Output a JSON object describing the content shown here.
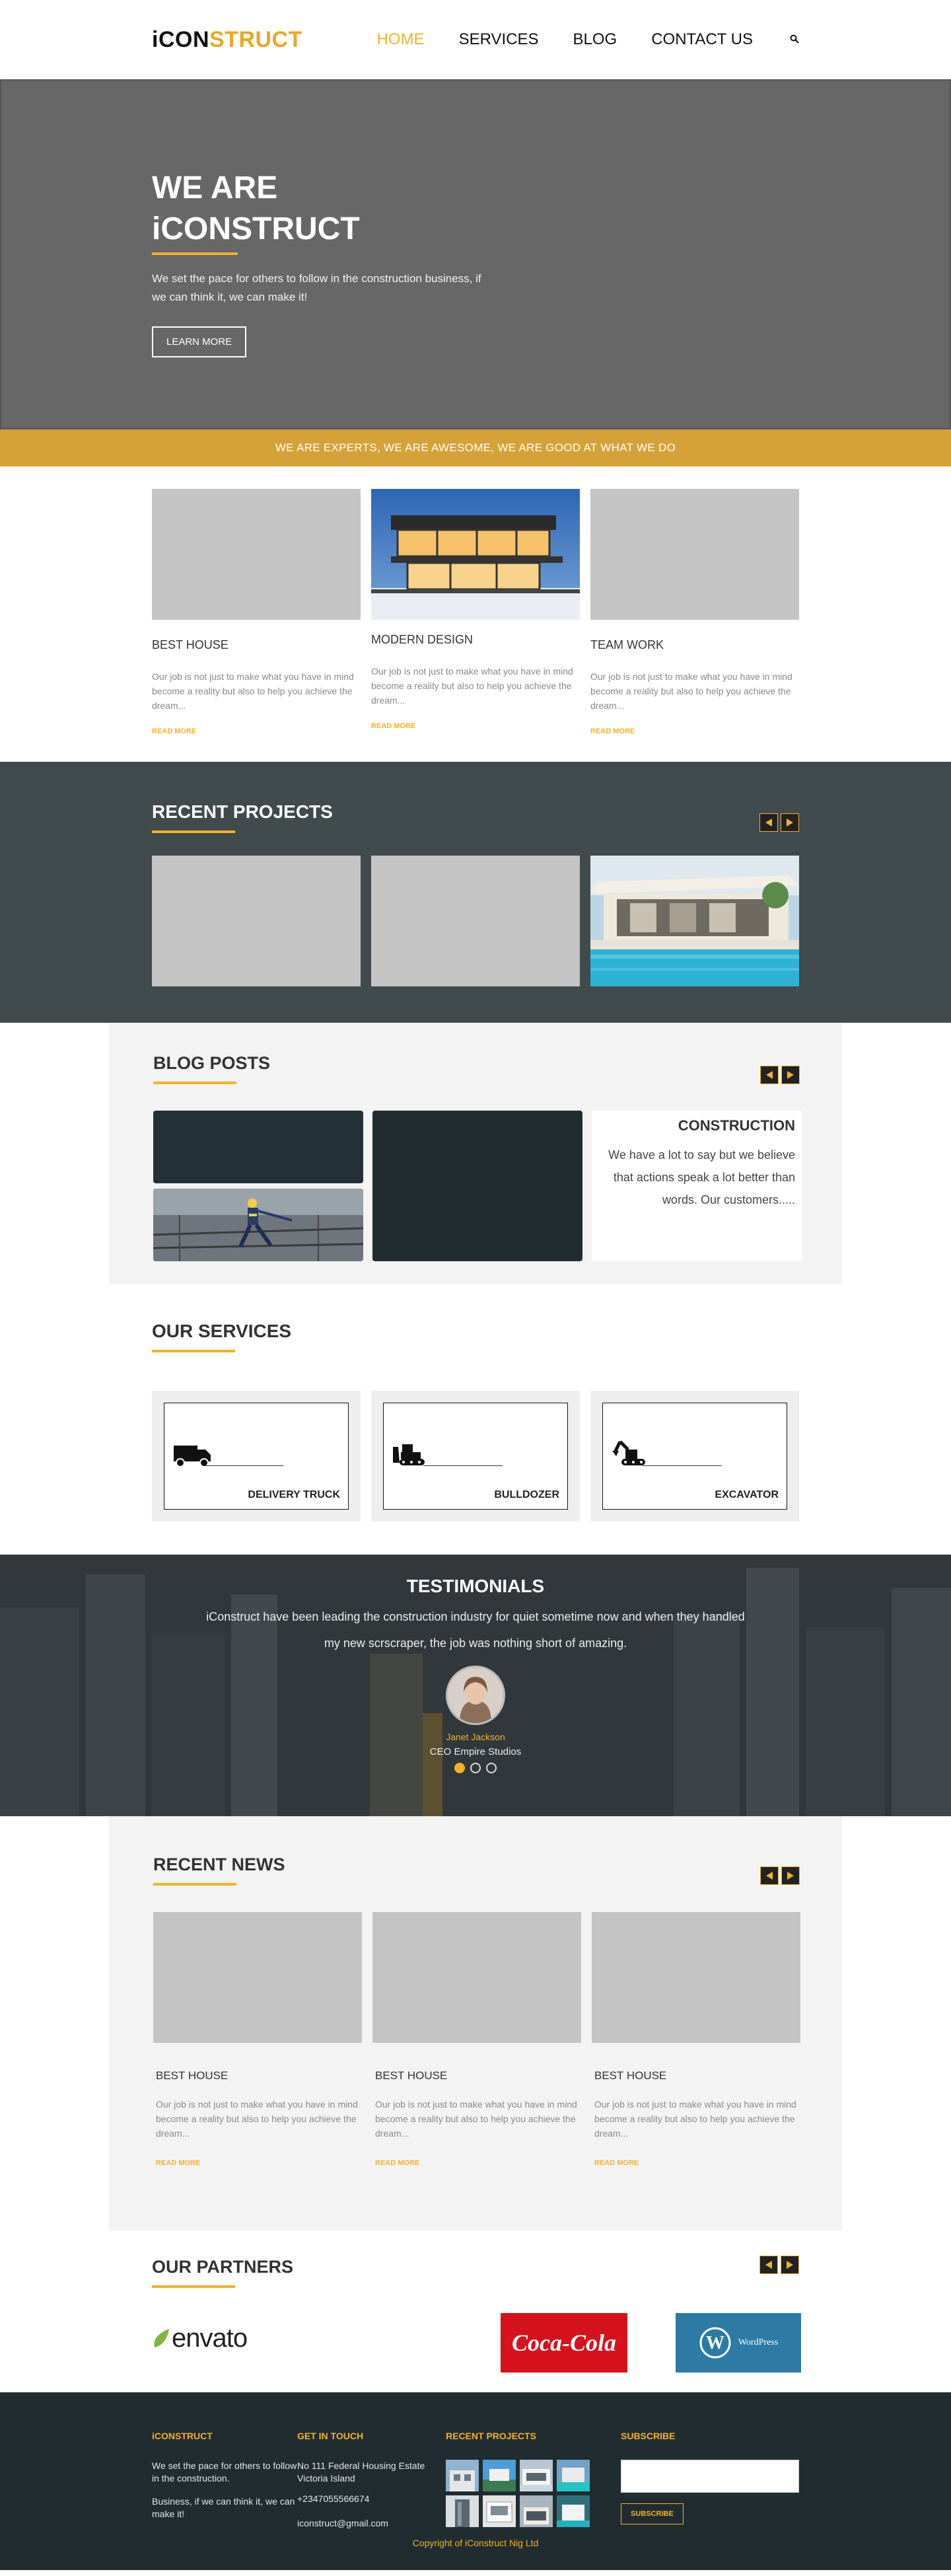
{
  "nav": {
    "logo_prefix": "iCON",
    "logo_suffix": "STRUCT",
    "items": [
      {
        "label": "HOME",
        "active": true
      },
      {
        "label": "SERVICES"
      },
      {
        "label": "BLOG"
      },
      {
        "label": "CONTACT US"
      }
    ],
    "search_icon": "magnifier"
  },
  "hero": {
    "line1": "WE ARE",
    "line2": "iCONSTRUCT",
    "text": "We set the pace for others to follow in the construction business, if we can think it, we can make it!",
    "button": "LEARN MORE"
  },
  "banner": "WE ARE EXPERTS, WE ARE AWESOME, WE ARE GOOD AT WHAT WE DO",
  "features": [
    {
      "title": "BEST HOUSE",
      "text": "Our job is not just to make what you have in mind become a reality but also to help you achieve the dream...",
      "more": "READ MORE"
    },
    {
      "title": "MODERN DESIGN",
      "text": "Our job is not just to make what you have in mind become a reality but also to help you achieve the dream...",
      "more": "READ MORE"
    },
    {
      "title": "TEAM WORK",
      "text": "Our job is not just to make what you have in mind become a reality but also to help you achieve the dream...",
      "more": "READ MORE"
    }
  ],
  "projects": {
    "title": "RECENT PROJECTS"
  },
  "blog": {
    "title": "BLOG POSTS",
    "post_title": "CONSTRUCTION",
    "post_text": "We have a lot to say but we believe that actions speak a lot better than words. Our customers....."
  },
  "services": {
    "title": "OUR SERVICES",
    "items": [
      {
        "label": "DELIVERY TRUCK",
        "icon": "truck-icon"
      },
      {
        "label": "BULLDOZER",
        "icon": "bulldozer-icon"
      },
      {
        "label": "EXCAVATOR",
        "icon": "excavator-icon"
      }
    ]
  },
  "testimonials": {
    "title": "TESTIMONIALS",
    "quote": "iConstruct have been leading the construction industry for quiet sometime now and when they handled my new scrscraper, the job was nothing short of amazing.",
    "name": "Janet Jackson",
    "company": "CEO Empire Studios"
  },
  "news": {
    "title": "RECENT NEWS",
    "items": [
      {
        "title": "BEST HOUSE",
        "text": "Our job is not just to make what you have in mind become a reality but also to help you achieve the dream...",
        "more": "READ MORE"
      },
      {
        "title": "BEST HOUSE",
        "text": "Our job is not just to make what you have in mind become a reality but also to help you achieve the dream...",
        "more": "READ MORE"
      },
      {
        "title": "BEST HOUSE",
        "text": "Our job is not just to make what you have in mind become a reality but also to help you achieve the dream...",
        "more": "READ MORE"
      }
    ]
  },
  "partners": {
    "title": "OUR PARTNERS",
    "envato": "envato",
    "coke": "Coca-Cola",
    "wordpress": "WordPress"
  },
  "footer": {
    "col1_title": "iCONSTRUCT",
    "col1_p1": "We set the pace for others to follow in the construction.",
    "col1_p2": "Business, if we can think it, we can make it!",
    "col2_title": "GET IN TOUCH",
    "address": "No 111 Federal Housing Estate Victoria Island",
    "phone": "+2347055566674",
    "email": "iconstruct@gmail.com",
    "col3_title": "RECENT PROJECTS",
    "col4_title": "SUBSCRIBE",
    "subscribe_button": "SUBSCRIBE",
    "copyright": "Copyright of iConstruct Nig Ltd"
  },
  "colors": {
    "accent": "#f3b22a",
    "dark": "#212c30",
    "projects_bg": "#414a4c",
    "banner": "#d4a239"
  }
}
